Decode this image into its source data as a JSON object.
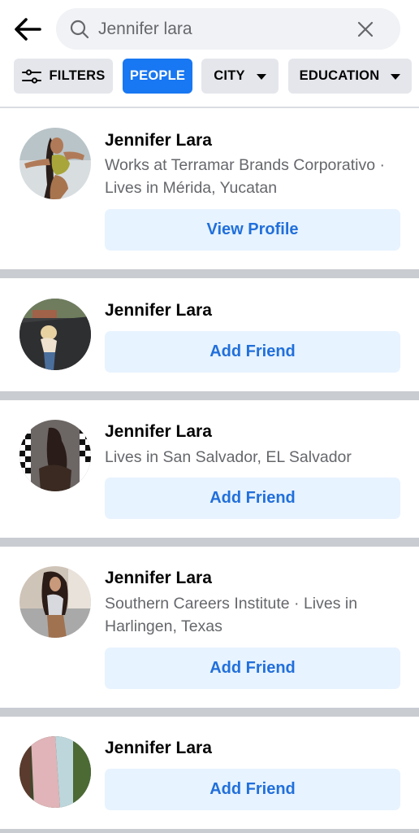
{
  "header": {
    "back_icon": "arrow-left-icon",
    "search": {
      "value": "Jennifer lara",
      "placeholder": "Search",
      "search_icon": "search-icon",
      "clear_icon": "close-icon"
    },
    "filters": [
      {
        "label": "FILTERS",
        "icon": "filter-sliders-icon",
        "active": false,
        "dropdown": false
      },
      {
        "label": "PEOPLE",
        "active": true,
        "dropdown": false
      },
      {
        "label": "CITY",
        "active": false,
        "dropdown": true
      },
      {
        "label": "EDUCATION",
        "active": false,
        "dropdown": true
      }
    ]
  },
  "results": [
    {
      "name": "Jennifer Lara",
      "details": "Works at Terramar Brands Corporativo · Lives in Mérida, Yucatan",
      "action": "View Profile"
    },
    {
      "name": "Jennifer Lara",
      "details": "",
      "action": "Add Friend"
    },
    {
      "name": "Jennifer Lara",
      "details": "Lives in San Salvador, EL Salvador",
      "action": "Add Friend"
    },
    {
      "name": "Jennifer Lara",
      "details": "Southern Careers Institute · Lives in Harlingen, Texas",
      "action": "Add Friend"
    },
    {
      "name": "Jennifer Lara",
      "details": "",
      "action": "Add Friend"
    }
  ],
  "colors": {
    "accent": "#1877f2",
    "action_bg": "#e7f3ff",
    "action_text": "#216fdb",
    "chip_bg": "#e4e6eb",
    "divider": "#c9ccd1",
    "secondary_text": "#65676b"
  }
}
